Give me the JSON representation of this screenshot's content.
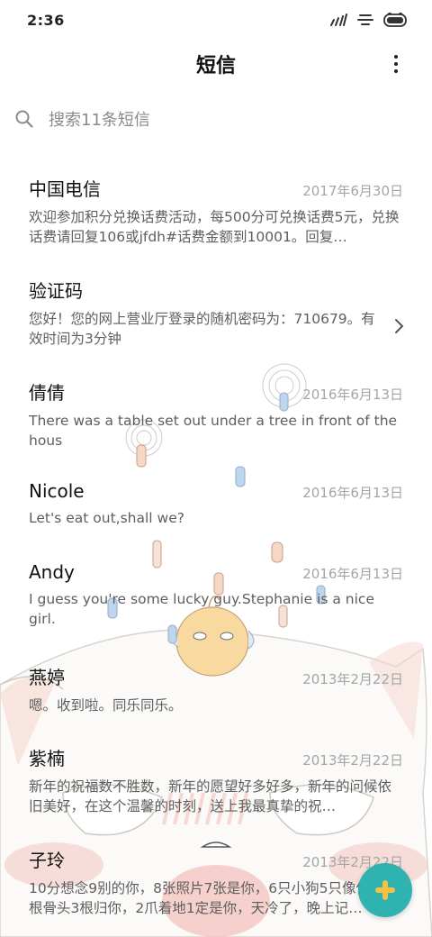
{
  "status": {
    "time": "2:36",
    "icons": [
      "signal-off-icon",
      "wifi-icon",
      "battery-icon"
    ]
  },
  "header": {
    "title": "短信",
    "menu_icon": "more-vertical-icon"
  },
  "search": {
    "placeholder": "搜索11条短信",
    "icon": "search-icon"
  },
  "conversations": [
    {
      "name": "中国电信",
      "date": "2017年6月30日",
      "snippet": "欢迎参加积分兑换话费活动，每500分可兑换话费5元，兑换话费请回复106或jfdh#话费金额到10001。回复…"
    },
    {
      "name": "验证码",
      "date": "",
      "snippet": "您好！您的网上营业厅登录的随机密码为：710679。有效时间为3分钟"
    },
    {
      "name": "倩倩",
      "date": "2016年6月13日",
      "snippet": "There was a table set out under a tree in front of the hous"
    },
    {
      "name": "Nicole",
      "date": "2016年6月13日",
      "snippet": "Let's eat out,shall we?"
    },
    {
      "name": "Andy",
      "date": "2016年6月13日",
      "snippet": "I guess you're some lucky guy.Stephanie is a nice girl."
    },
    {
      "name": "燕婷",
      "date": "2013年2月22日",
      "snippet": "嗯。收到啦。同乐同乐。"
    },
    {
      "name": "紫楠",
      "date": "2013年2月22日",
      "snippet": "新年的祝福数不胜数，新年的愿望好多好多，新年的问候依旧美好，在这个温馨的时刻，送上我最真挚的祝…"
    },
    {
      "name": "子玲",
      "date": "2013年2月22日",
      "snippet": "10分想念9别的你，8张照片7张是你，6只小狗5只像你，4根骨头3根归你，2爪着地1定是你，天冷了，晚上记…"
    }
  ],
  "fab": {
    "icon": "plus-icon"
  },
  "colors": {
    "accent": "#2fb3b0",
    "fab_plus": "#f6c244"
  }
}
